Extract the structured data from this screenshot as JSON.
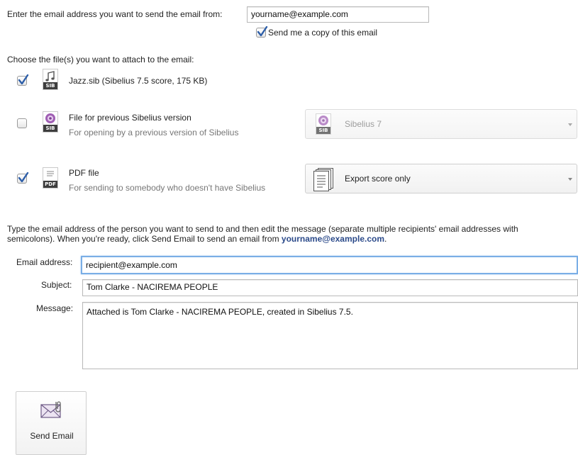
{
  "from": {
    "label": "Enter the email address you want to send the email from:",
    "value": "yourname@example.com",
    "copy_checkbox": {
      "label": "Send me a copy of this email",
      "checked": true
    }
  },
  "attach": {
    "heading": "Choose the file(s) you want to attach to the email:",
    "files": [
      {
        "title": "Jazz.sib (Sibelius 7.5 score, 175 KB)",
        "checked": true,
        "icon": "music-note-file-icon",
        "badge": "SIB"
      },
      {
        "title": "File for previous Sibelius version",
        "subtitle": "For opening by a previous version of Sibelius",
        "checked": false,
        "icon": "sibelius-file-icon",
        "badge": "SIB"
      },
      {
        "title": "PDF file",
        "subtitle": "For sending to somebody who doesn't have Sibelius",
        "checked": true,
        "icon": "pdf-file-icon",
        "badge": "PDF"
      }
    ],
    "version_select": {
      "value": "Sibelius 7",
      "badge": "SIB",
      "disabled": true
    },
    "pdf_select": {
      "value": "Export score only"
    }
  },
  "recipient": {
    "instructions_line1": "Type the email address of the person you want to send to and then edit the message (separate multiple recipients' email addresses with",
    "instructions_line2_prefix": "semicolons). When you're ready, click Send Email to send an email from ",
    "instructions_email": "yourname@example.com",
    "instructions_suffix": ".",
    "email_label": "Email address:",
    "email_value": "recipient@example.com",
    "subject_label": "Subject:",
    "subject_value": "Tom Clarke - NACIREMA PEOPLE",
    "message_label": "Message:",
    "message_value": "Attached is Tom Clarke - NACIREMA PEOPLE, created in Sibelius 7.5."
  },
  "send_button": {
    "label": "Send Email",
    "icon": "envelope-attachment-icon"
  },
  "colors": {
    "link": "#2b4a8a",
    "check": "#2d5ea8",
    "focus": "#7aaee6"
  }
}
